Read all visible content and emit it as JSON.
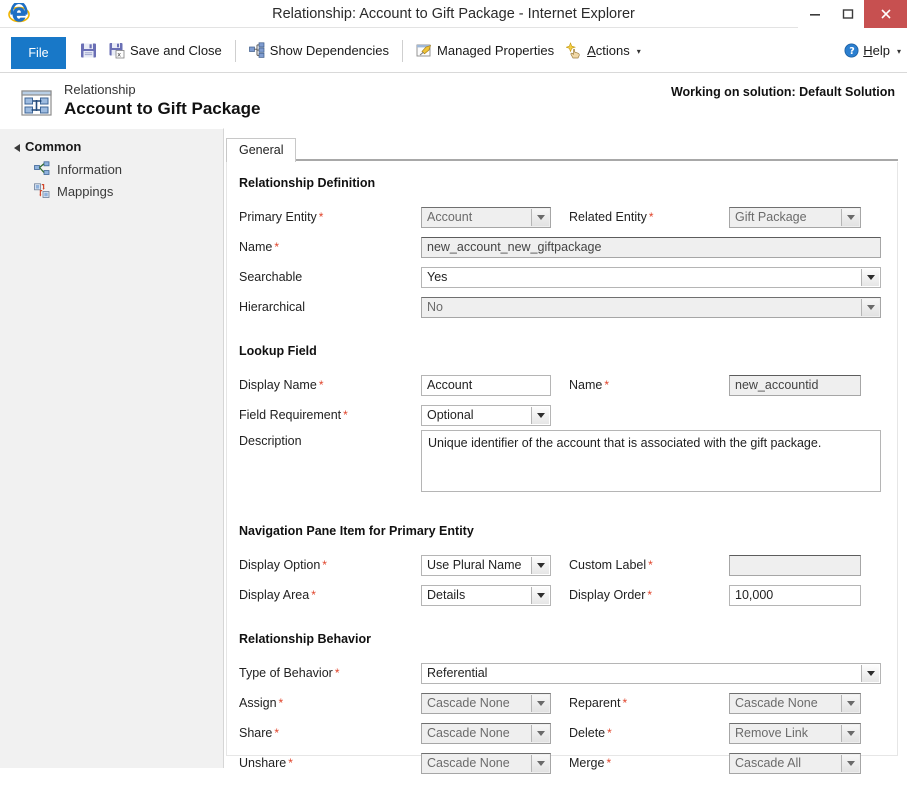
{
  "window": {
    "title": "Relationship: Account to Gift Package - Internet Explorer",
    "minimize_label": "–",
    "maximize_label": "❑",
    "close_label": "✕",
    "logo_icon": "internet-explorer-icon"
  },
  "ribbon": {
    "file_label": "File",
    "save_icon": "save-icon",
    "save_and_close_icon": "save-and-close-icon",
    "save_and_close_label": "Save and Close",
    "show_dependencies_icon": "dependencies-icon",
    "show_dependencies_label": "Show Dependencies",
    "managed_properties_icon": "managed-properties-icon",
    "managed_properties_label": "Managed Properties",
    "actions_icon": "actions-icon",
    "actions_label": "Actions",
    "actions_caret": "▾",
    "help_icon": "help-icon",
    "help_label": "Help",
    "help_caret": "▾"
  },
  "header": {
    "entity_icon": "relationship-icon",
    "subtitle": "Relationship",
    "title": "Account to Gift Package",
    "solution_note": "Working on solution: Default Solution"
  },
  "sidebar": {
    "group_label": "Common",
    "items": [
      {
        "label": "Information",
        "icon": "information-icon"
      },
      {
        "label": "Mappings",
        "icon": "mappings-icon"
      }
    ]
  },
  "tabs": [
    {
      "label": "General",
      "active": true
    }
  ],
  "form": {
    "sections": {
      "relationship_definition": {
        "title": "Relationship Definition",
        "primary_entity": {
          "label": "Primary Entity",
          "required": "*",
          "value": "Account",
          "disabled": true
        },
        "related_entity": {
          "label": "Related Entity",
          "required": "*",
          "value": "Gift Package",
          "disabled": true
        },
        "name": {
          "label": "Name",
          "required": "*",
          "value": "new_account_new_giftpackage",
          "disabled": true
        },
        "searchable": {
          "label": "Searchable",
          "required": "",
          "value": "Yes",
          "disabled": false
        },
        "hierarchical": {
          "label": "Hierarchical",
          "required": "",
          "value": "No",
          "disabled": true
        }
      },
      "lookup_field": {
        "title": "Lookup Field",
        "display_name": {
          "label": "Display Name",
          "required": "*",
          "value": "Account",
          "disabled": false
        },
        "name": {
          "label": "Name",
          "required": "*",
          "value": "new_accountid",
          "disabled": true
        },
        "field_requirement": {
          "label": "Field Requirement",
          "required": "*",
          "value": "Optional",
          "disabled": false
        },
        "description": {
          "label": "Description",
          "required": "",
          "value": "Unique identifier of the account that is associated with the gift package."
        }
      },
      "navigation_pane": {
        "title": "Navigation Pane Item for Primary Entity",
        "display_option": {
          "label": "Display Option",
          "required": "*",
          "value": "Use Plural Name",
          "disabled": false
        },
        "custom_label": {
          "label": "Custom Label",
          "required": "*",
          "value": "",
          "disabled": true
        },
        "display_area": {
          "label": "Display Area",
          "required": "*",
          "value": "Details",
          "disabled": false
        },
        "display_order": {
          "label": "Display Order",
          "required": "*",
          "value": "10,000",
          "disabled": false
        }
      },
      "relationship_behavior": {
        "title": "Relationship Behavior",
        "type_of_behavior": {
          "label": "Type of Behavior",
          "required": "*",
          "value": "Referential",
          "disabled": false
        },
        "assign": {
          "label": "Assign",
          "required": "*",
          "value": "Cascade None",
          "disabled": true
        },
        "reparent": {
          "label": "Reparent",
          "required": "*",
          "value": "Cascade None",
          "disabled": true
        },
        "share": {
          "label": "Share",
          "required": "*",
          "value": "Cascade None",
          "disabled": true
        },
        "delete": {
          "label": "Delete",
          "required": "*",
          "value": "Remove Link",
          "disabled": true
        },
        "unshare": {
          "label": "Unshare",
          "required": "*",
          "value": "Cascade None",
          "disabled": true
        },
        "merge": {
          "label": "Merge",
          "required": "*",
          "value": "Cascade All",
          "disabled": true
        }
      }
    }
  },
  "colors": {
    "file_button": "#1878c8",
    "close_button": "#c75050",
    "required_asterisk": "#e0442b",
    "sidebar_bg": "#f1f1f1"
  }
}
